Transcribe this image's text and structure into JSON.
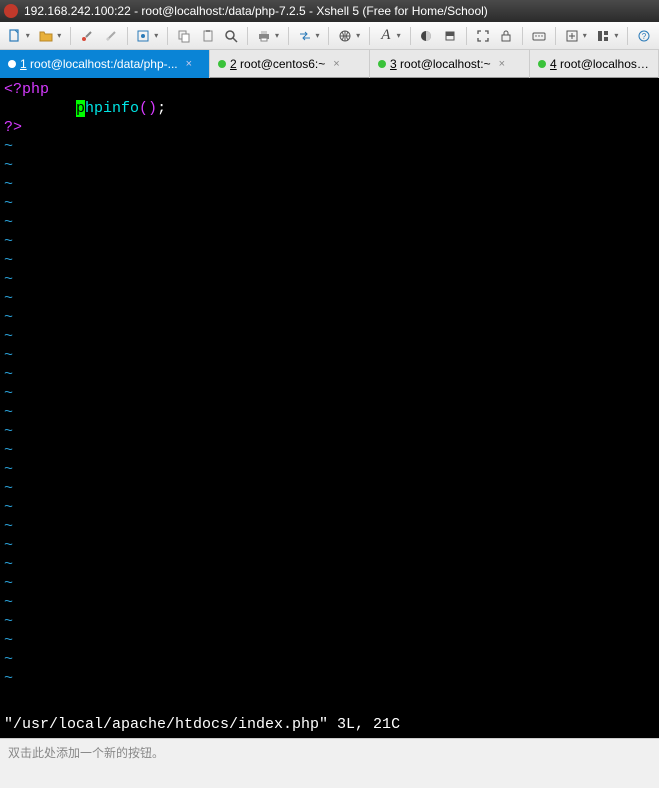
{
  "window": {
    "title": "192.168.242.100:22 - root@localhost:/data/php-7.2.5 - Xshell 5 (Free for Home/School)"
  },
  "tabs": {
    "t1_num": "1",
    "t1_label": " root@localhost:/data/php-...",
    "t2_num": "2",
    "t2_label": " root@centos6:~",
    "t3_num": "3",
    "t3_label": " root@localhost:~",
    "t4_num": "4",
    "t4_label": " root@localhost:~"
  },
  "editor": {
    "line1": "<?php",
    "indent": "        ",
    "cursor_char": "p",
    "func_rest": "hpinfo",
    "parens": "()",
    "semi": ";",
    "line3": "?>",
    "tilde": "~",
    "status": "\"/usr/local/apache/htdocs/index.php\" 3L, 21C"
  },
  "bottombar": {
    "hint": "双击此处添加一个新的按钮。"
  }
}
